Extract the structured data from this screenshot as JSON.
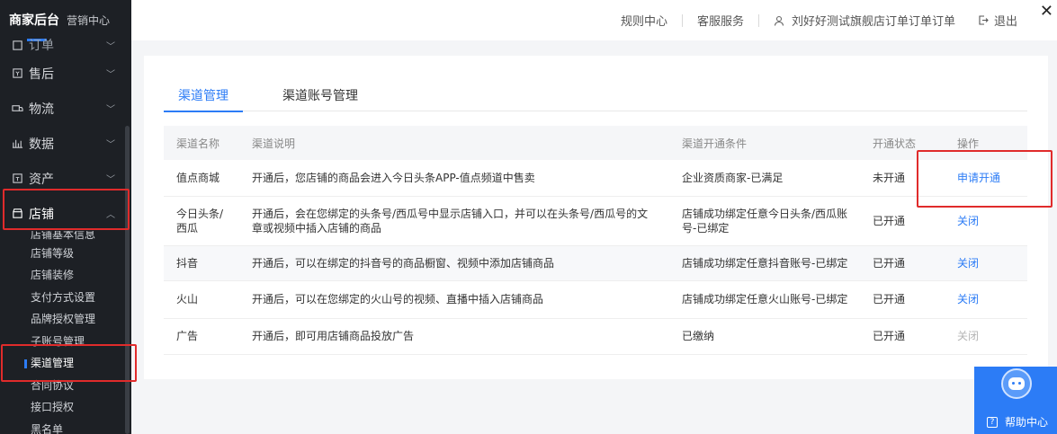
{
  "sidebar": {
    "brand_title": "商家后台",
    "brand_sub": "营销中心",
    "items": [
      {
        "label": "订单",
        "icon": "order-icon"
      },
      {
        "label": "售后",
        "icon": "aftersale-icon"
      },
      {
        "label": "物流",
        "icon": "truck-icon"
      },
      {
        "label": "数据",
        "icon": "chart-icon"
      },
      {
        "label": "资产",
        "icon": "asset-icon"
      },
      {
        "label": "店铺",
        "icon": "shop-icon"
      }
    ],
    "shop_sub": [
      "店铺基本信息",
      "店铺等级",
      "店铺装修",
      "支付方式设置",
      "品牌授权管理",
      "子账号管理",
      "渠道管理",
      "合同协议",
      "接口授权",
      "黑名单"
    ]
  },
  "topbar": {
    "rules": "规则中心",
    "service": "客服服务",
    "user": "刘好好测试旗舰店订单订单订单",
    "logout": "退出"
  },
  "tabs": [
    "渠道管理",
    "渠道账号管理"
  ],
  "table": {
    "headers": [
      "渠道名称",
      "渠道说明",
      "渠道开通条件",
      "开通状态",
      "操作"
    ],
    "rows": [
      {
        "name": "值点商城",
        "desc": "开通后，您店铺的商品会进入今日头条APP-值点频道中售卖",
        "cond": "企业资质商家-已满足",
        "status": "未开通",
        "op": "申请开通"
      },
      {
        "name": "今日头条/西瓜",
        "desc": "开通后，会在您绑定的头条号/西瓜号中显示店铺入口，并可以在头条号/西瓜号的文章或视频中插入店铺的商品",
        "cond": "店铺成功绑定任意今日头条/西瓜账号-已绑定",
        "status": "已开通",
        "op": "关闭"
      },
      {
        "name": "抖音",
        "desc": "开通后，可以在绑定的抖音号的商品橱窗、视频中添加店铺商品",
        "cond": "店铺成功绑定任意抖音账号-已绑定",
        "status": "已开通",
        "op": "关闭"
      },
      {
        "name": "火山",
        "desc": "开通后，可以在您绑定的火山号的视频、直播中插入店铺商品",
        "cond": "店铺成功绑定任意火山账号-已绑定",
        "status": "已开通",
        "op": "关闭"
      },
      {
        "name": "广告",
        "desc": "开通后，即可用店铺商品投放广告",
        "cond": "已缴纳",
        "status": "已开通",
        "op": "关闭"
      }
    ]
  },
  "help": {
    "label": "帮助中心"
  },
  "colors": {
    "accent": "#2c7cf6",
    "sidebar_bg": "#1d2025",
    "highlight": "#e02b2b"
  }
}
